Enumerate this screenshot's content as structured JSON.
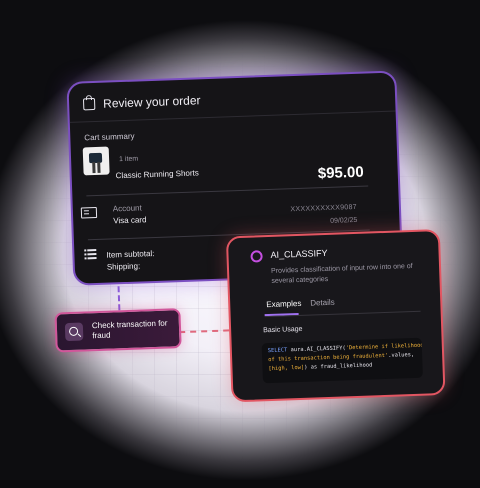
{
  "order_card": {
    "title": "Review your order",
    "cart_summary_label": "Cart summary",
    "item_count": "1 item",
    "item_name": "Classic Running Shorts",
    "price": "$95.00",
    "account_label": "Account",
    "account_value": "Visa card",
    "card_number": "XXXXXXXXXX9087",
    "card_expiry": "09/02/25",
    "subtotal_label": "Item subtotal:",
    "shipping_label": "Shipping:"
  },
  "fraud_pill": {
    "label": "Check transaction for fraud"
  },
  "classify_card": {
    "title": "AI_CLASSIFY",
    "description": "Provides classification of input row into one of several categories",
    "tabs": [
      {
        "label": "Examples",
        "active": true
      },
      {
        "label": "Details",
        "active": false
      }
    ],
    "section_label": "Basic Usage",
    "code": {
      "kw_select": "SELECT",
      "part1": " aura.AI_CLASSIFY(",
      "str1": "'Determine if likelihood",
      "str2": "of this transaction being fraudulent'",
      "part2": ".values,",
      "str3": "[high, low]",
      "part3": ") as fraud_likelihood"
    }
  },
  "colors": {
    "order_border": "#7b4fc1",
    "classify_border": "#e25662",
    "pill_border": "#d1569a",
    "tab_accent": "#a071f0"
  },
  "icons": [
    "shopping-bag-icon",
    "credit-card-icon",
    "list-icon",
    "search-icon",
    "classify-dot-icon"
  ]
}
